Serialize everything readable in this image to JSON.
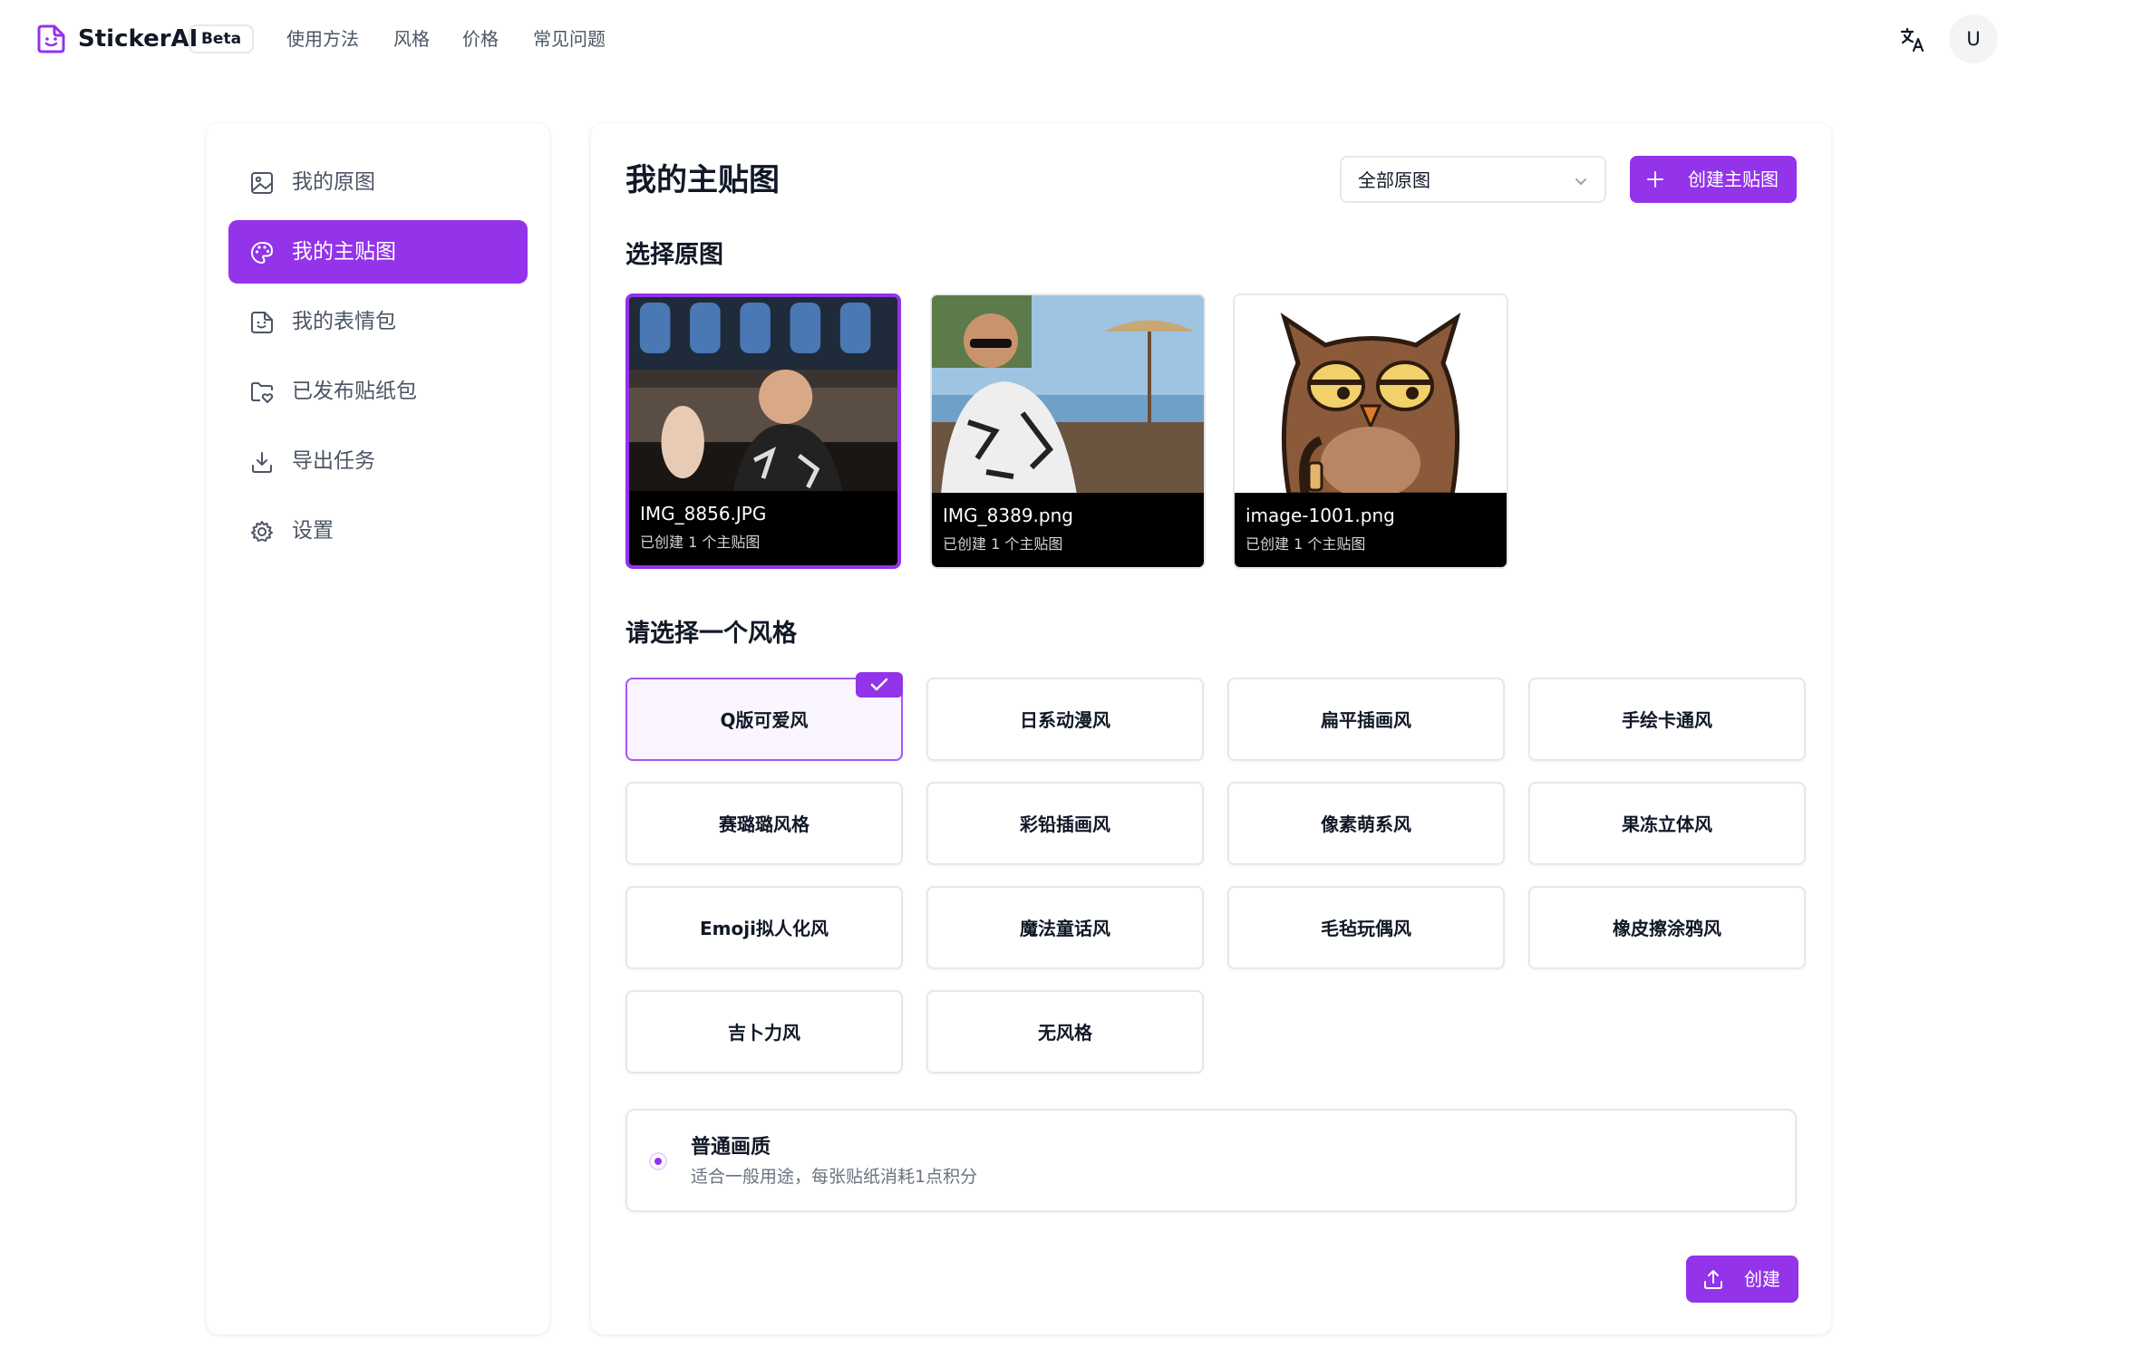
{
  "app": {
    "name": "StickerAI",
    "badge": "Beta"
  },
  "nav": {
    "links": [
      "使用方法",
      "风格",
      "价格",
      "常见问题"
    ],
    "avatar_initial": "U"
  },
  "sidebar": {
    "items": [
      {
        "label": "我的原图",
        "icon": "image-icon",
        "active": false
      },
      {
        "label": "我的主贴图",
        "icon": "palette-icon",
        "active": true
      },
      {
        "label": "我的表情包",
        "icon": "sticker-icon",
        "active": false
      },
      {
        "label": "已发布贴纸包",
        "icon": "folder-heart-icon",
        "active": false
      },
      {
        "label": "导出任务",
        "icon": "download-icon",
        "active": false
      },
      {
        "label": "设置",
        "icon": "gear-icon",
        "active": false
      }
    ]
  },
  "main": {
    "title": "我的主贴图",
    "filter": {
      "selected": "全部原图"
    },
    "create_button": "创建主贴图",
    "select_source_title": "选择原图",
    "photos": [
      {
        "filename": "IMG_8856.JPG",
        "meta": "已创建 1 个主贴图",
        "selected": true
      },
      {
        "filename": "IMG_8389.png",
        "meta": "已创建 1 个主贴图",
        "selected": false
      },
      {
        "filename": "image-1001.png",
        "meta": "已创建 1 个主贴图",
        "selected": false
      }
    ],
    "style_section_title": "请选择一个风格",
    "styles": [
      {
        "label": "Q版可爱风",
        "selected": true
      },
      {
        "label": "日系动漫风",
        "selected": false
      },
      {
        "label": "扁平插画风",
        "selected": false
      },
      {
        "label": "手绘卡通风",
        "selected": false
      },
      {
        "label": "赛璐璐风格",
        "selected": false
      },
      {
        "label": "彩铅插画风",
        "selected": false
      },
      {
        "label": "像素萌系风",
        "selected": false
      },
      {
        "label": "果冻立体风",
        "selected": false
      },
      {
        "label": "Emoji拟人化风",
        "selected": false
      },
      {
        "label": "魔法童话风",
        "selected": false
      },
      {
        "label": "毛毡玩偶风",
        "selected": false
      },
      {
        "label": "橡皮擦涂鸦风",
        "selected": false
      },
      {
        "label": "吉卜力风",
        "selected": false
      },
      {
        "label": "无风格",
        "selected": false
      }
    ],
    "quality": {
      "title": "普通画质",
      "description": "适合一般用途，每张贴纸消耗1点积分",
      "selected": true
    },
    "submit_button": "创建"
  },
  "colors": {
    "accent": "#9333ea",
    "accent_light": "#faf5ff",
    "border": "#e5e7eb",
    "text_muted": "#4b5563"
  }
}
